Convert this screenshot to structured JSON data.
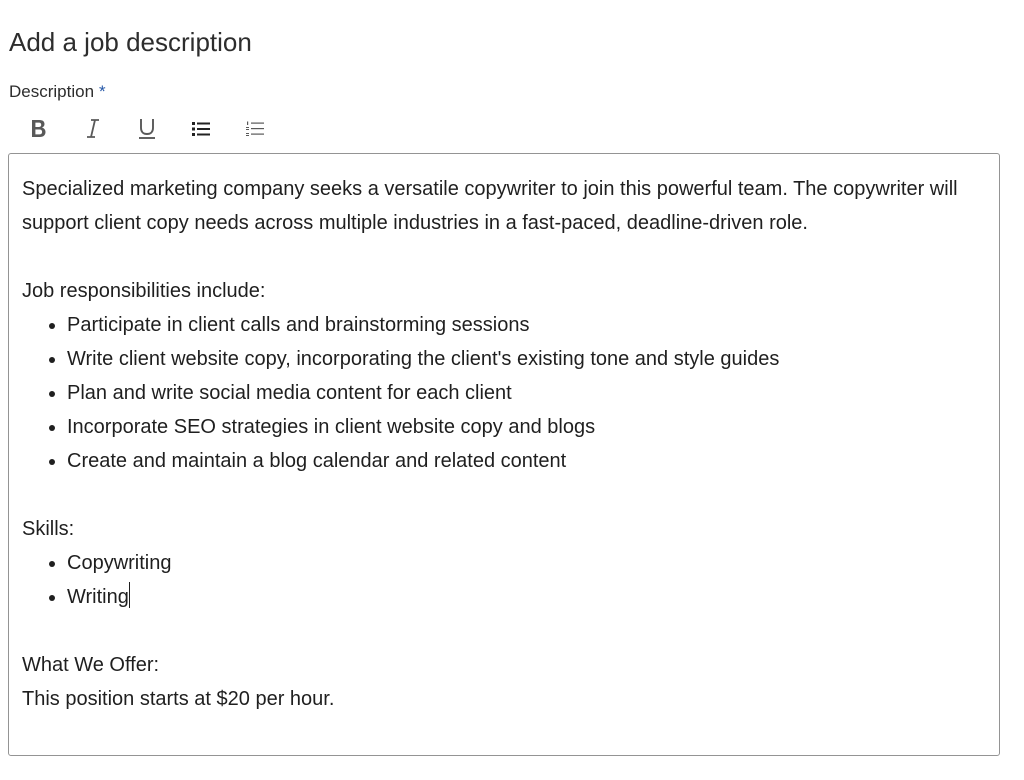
{
  "page": {
    "title": "Add a job description"
  },
  "field": {
    "label": "Description",
    "required_mark": "*"
  },
  "toolbar": {
    "buttons": [
      {
        "name": "bold",
        "icon": "bold-icon"
      },
      {
        "name": "italic",
        "icon": "italic-icon"
      },
      {
        "name": "underline",
        "icon": "underline-icon"
      },
      {
        "name": "bulleted-list",
        "icon": "bulleted-list-icon"
      },
      {
        "name": "numbered-list",
        "icon": "numbered-list-icon"
      }
    ]
  },
  "editor": {
    "intro": "Specialized marketing company seeks a versatile copywriter to join this powerful team. The copywriter will support client copy needs across multiple industries in a fast-paced, deadline-driven role.",
    "responsibilities_heading": "Job responsibilities include:",
    "responsibilities": [
      "Participate in client calls and brainstorming sessions",
      "Write client website copy, incorporating the client's existing tone and style guides",
      "Plan and write social media content for each client",
      "Incorporate SEO strategies in client website copy and blogs",
      "Create and maintain a blog calendar and related content"
    ],
    "skills_heading": "Skills:",
    "skills": [
      "Copywriting",
      "Writing"
    ],
    "offer_heading": "What We Offer:",
    "offer_text": "This position starts at $20 per hour."
  },
  "colors": {
    "required_mark": "#2557a7",
    "toolbar_icon": "#595959",
    "editor_border": "#949494"
  }
}
